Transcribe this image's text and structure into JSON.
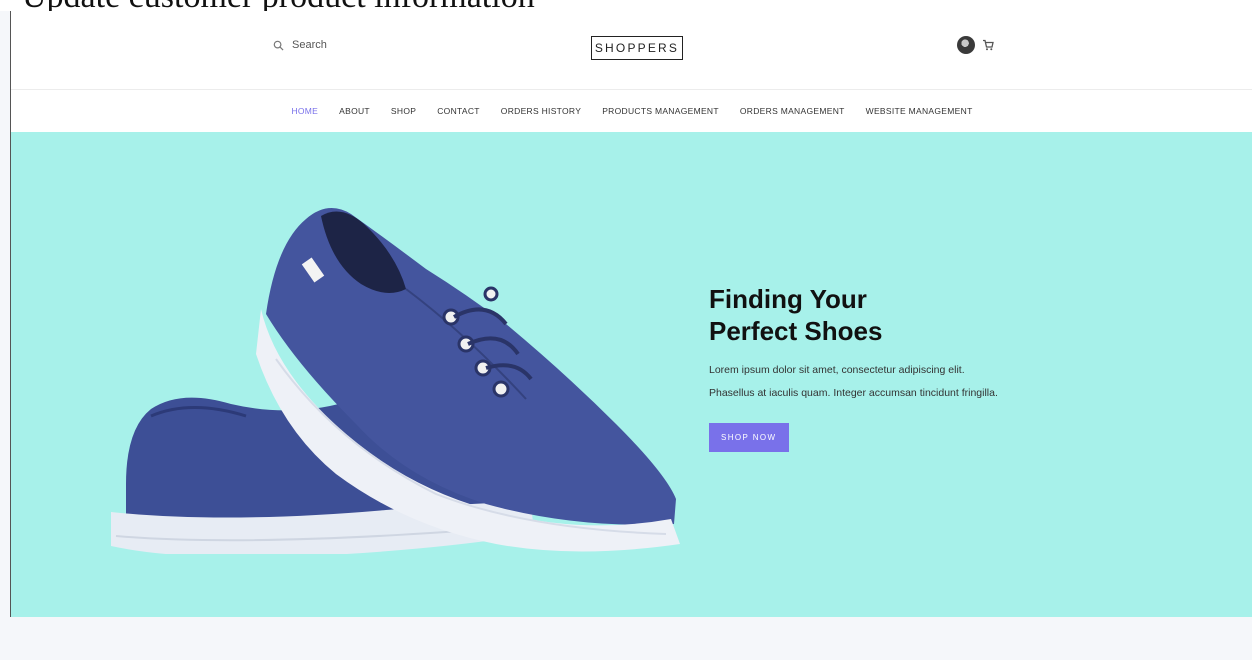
{
  "document_caption": "Update customer product information",
  "header": {
    "search_label": "Search",
    "logo": "SHOPPERS",
    "icons": [
      "search-icon",
      "avatar",
      "cart-icon"
    ]
  },
  "nav": {
    "items": [
      "HOME",
      "ABOUT",
      "SHOP",
      "CONTACT",
      "ORDERS HISTORY",
      "PRODUCTS MANAGEMENT",
      "ORDERS MANAGEMENT",
      "WEBSITE MANAGEMENT"
    ],
    "active": "HOME"
  },
  "hero": {
    "title": "Finding Your Perfect Shoes",
    "description": "Lorem ipsum dolor sit amet, consectetur adipiscing elit. Phasellus at iaculis quam. Integer accumsan tincidunt fringilla.",
    "button_label": "SHOP NOW",
    "image": "blue-canvas-sneakers"
  },
  "colors": {
    "accent": "#7971ea",
    "hero_background": "#a7f1ea",
    "page_background": "#f5f7fa"
  }
}
